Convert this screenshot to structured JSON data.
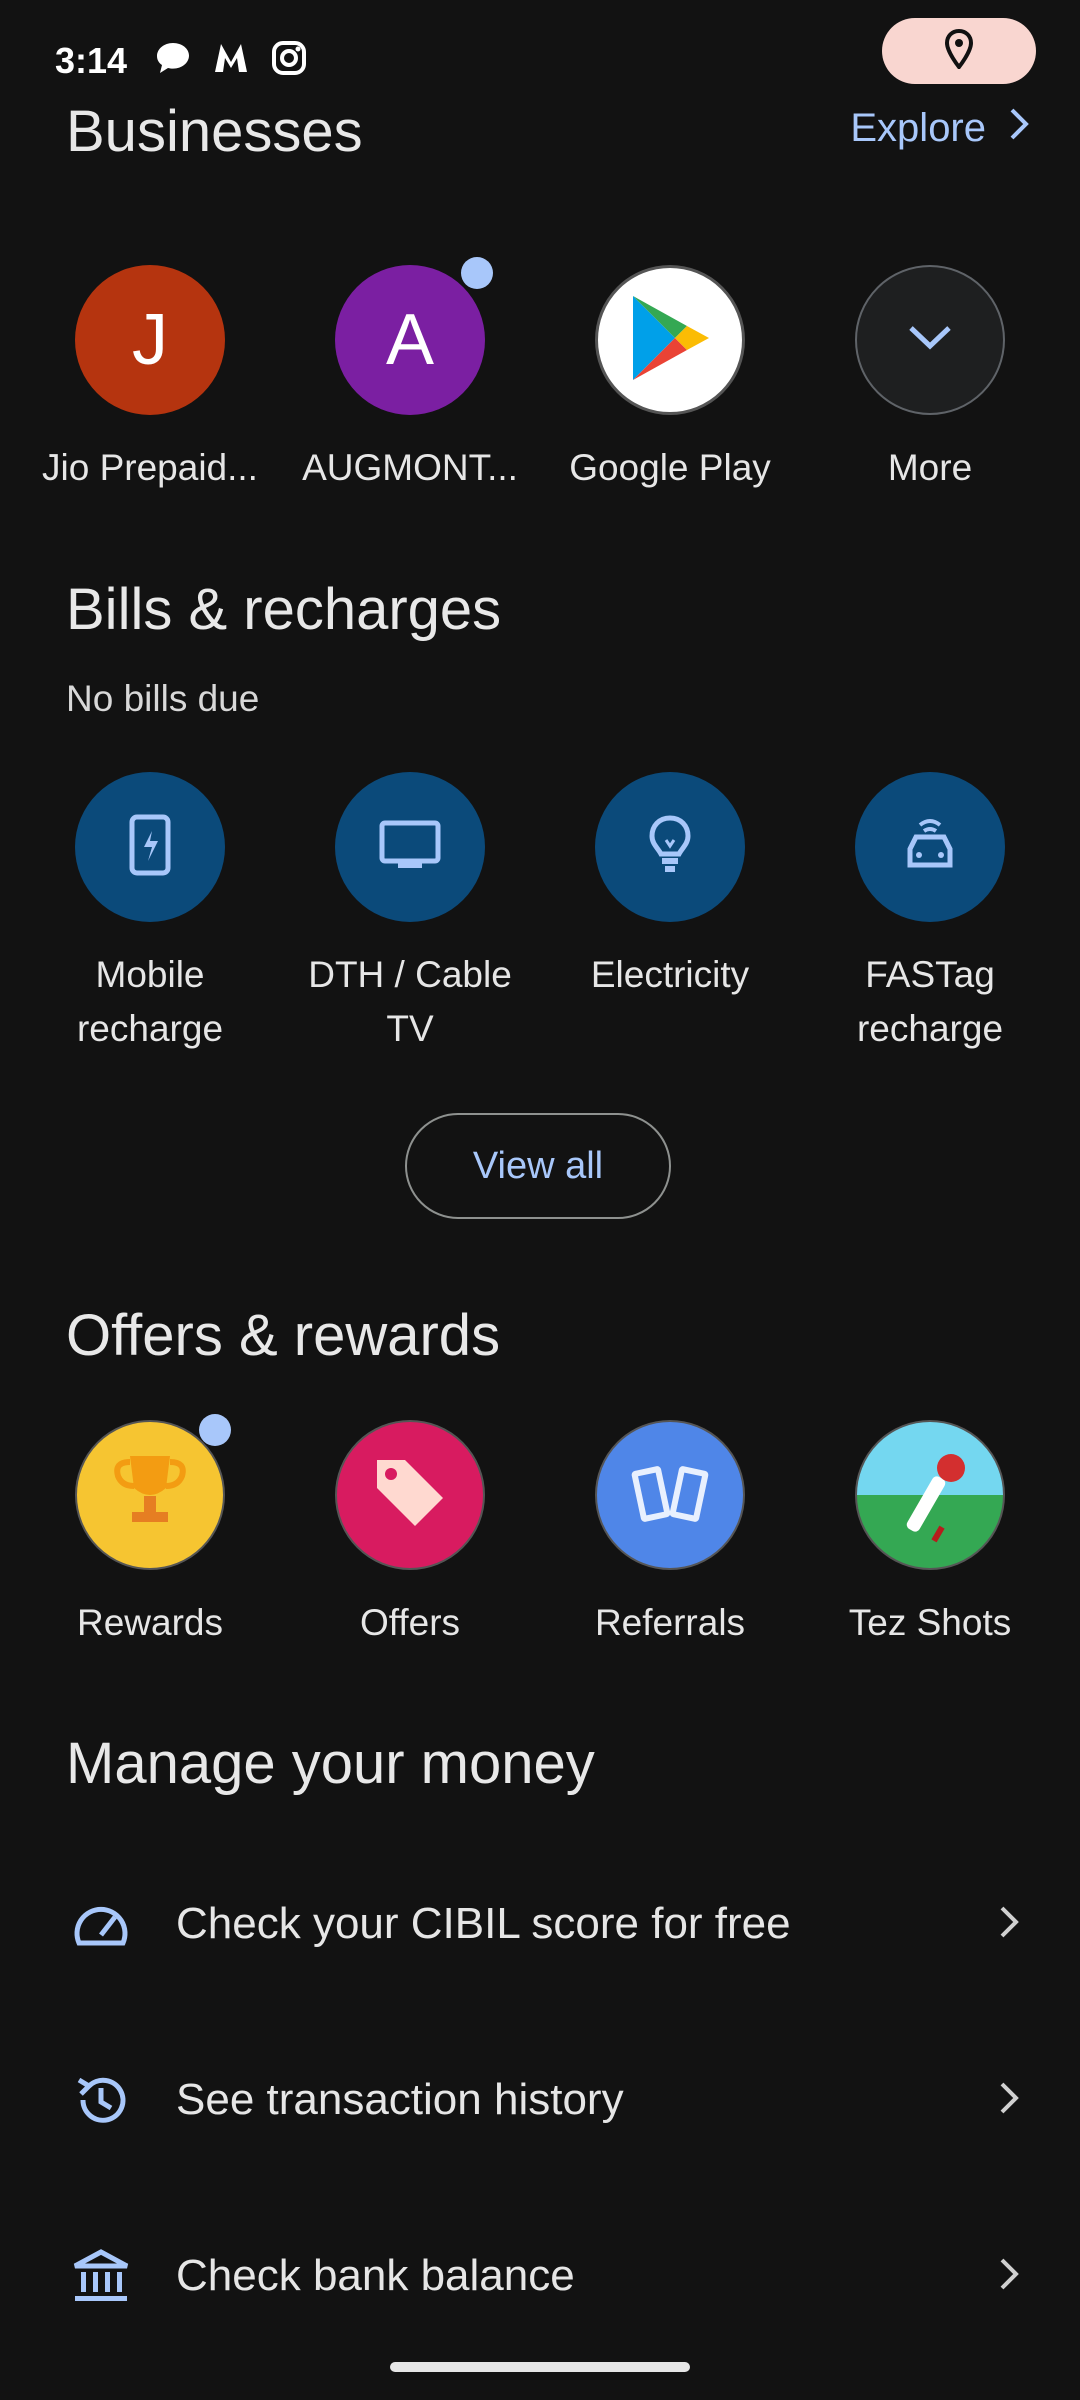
{
  "status": {
    "time": "3:14",
    "icons": [
      "chat-bubble-icon",
      "myntra-icon",
      "instagram-icon"
    ],
    "location_icon": "location-pin-icon"
  },
  "businesses": {
    "title": "Businesses",
    "explore": "Explore",
    "items": [
      {
        "letter": "J",
        "label": "Jio Prepaid...",
        "color": "#b5340f"
      },
      {
        "letter": "A",
        "label": "AUGMONT...",
        "color": "#7b1fa2",
        "badge": true
      },
      {
        "label": "Google Play",
        "icon": "google-play-icon"
      },
      {
        "label": "More",
        "icon": "chevron-down-icon"
      }
    ]
  },
  "bills": {
    "title": "Bills & recharges",
    "subtitle": "No bills due",
    "items": [
      {
        "label": "Mobile recharge",
        "icon": "phone-charge-icon"
      },
      {
        "label": "DTH / Cable TV",
        "icon": "tv-icon"
      },
      {
        "label": "Electricity",
        "icon": "bulb-icon"
      },
      {
        "label": "FASTag recharge",
        "icon": "car-icon"
      }
    ],
    "view_all": "View all"
  },
  "offers": {
    "title": "Offers & rewards",
    "items": [
      {
        "label": "Rewards",
        "icon": "trophy-icon",
        "badge": true
      },
      {
        "label": "Offers",
        "icon": "tag-icon"
      },
      {
        "label": "Referrals",
        "icon": "cards-icon"
      },
      {
        "label": "Tez Shots",
        "icon": "cricket-icon"
      }
    ]
  },
  "manage": {
    "title": "Manage your money",
    "items": [
      {
        "label": "Check your CIBIL score for free",
        "icon": "speedometer-icon"
      },
      {
        "label": "See transaction history",
        "icon": "history-icon"
      },
      {
        "label": "Check bank balance",
        "icon": "bank-icon"
      }
    ]
  },
  "colors": {
    "background": "#121212",
    "accent": "#a8c7fa",
    "bill_circle": "#0b4a7a",
    "location_pill": "#f9d6d0"
  }
}
